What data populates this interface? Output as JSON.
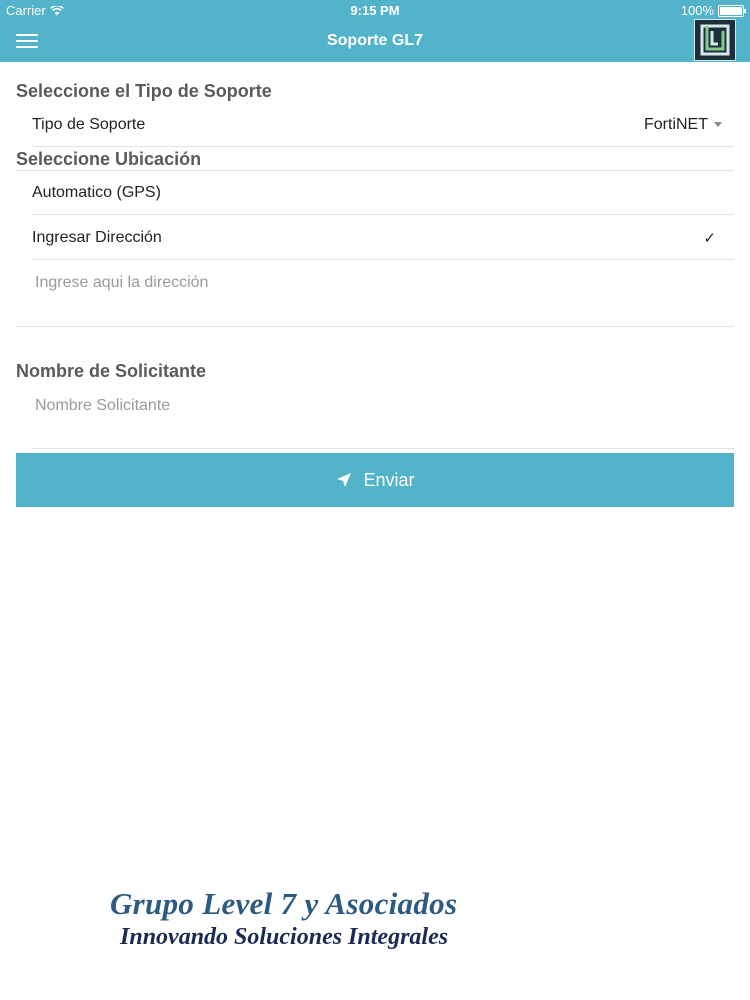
{
  "status": {
    "carrier": "Carrier",
    "time": "9:15 PM",
    "battery": "100%",
    "battery_level": 1.0
  },
  "nav": {
    "title": "Soporte GL7",
    "menu_icon": "hamburger-menu-icon",
    "logo_icon": "gl7-logo-icon"
  },
  "tipo_section": {
    "title": "Seleccione el Tipo de Soporte",
    "row_label": "Tipo de Soporte",
    "selected_value": "FortiNET"
  },
  "ubicacion_section": {
    "title": "Seleccione Ubicación",
    "options": [
      {
        "label": "Automatico (GPS)",
        "checked": false
      },
      {
        "label": "Ingresar Dirección",
        "checked": true
      }
    ],
    "check_mark": "✓",
    "address_placeholder": "Ingrese aqui la dirección"
  },
  "solicitante_section": {
    "title": "Nombre de Solicitante",
    "name_placeholder": "Nombre Solicitante"
  },
  "submit": {
    "label": "Enviar",
    "icon": "send-arrow-icon"
  },
  "footer": {
    "brand_line1": "Grupo Level 7 y Asociados",
    "brand_line2": "Innovando Soluciones Integrales"
  },
  "colors": {
    "accent": "#52b3cb",
    "section_title": "#5a5a5a",
    "brand_blue": "#2c5a83"
  }
}
